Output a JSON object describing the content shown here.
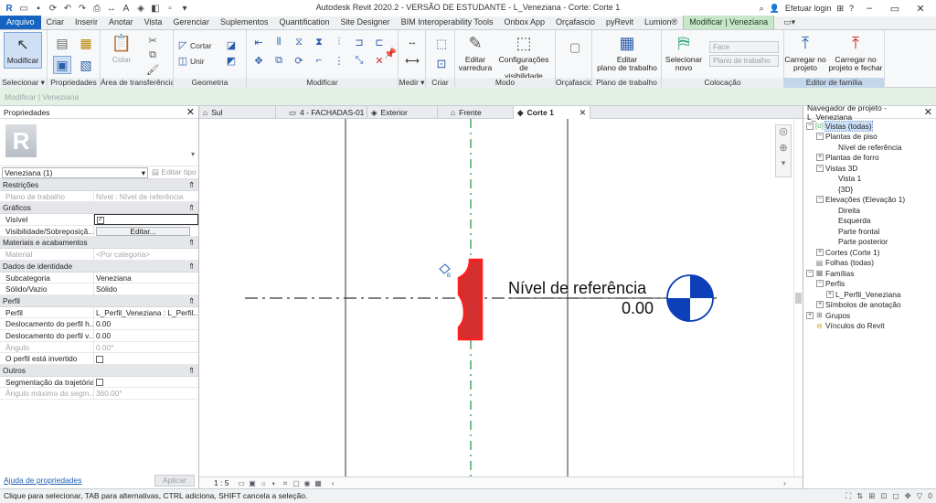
{
  "window": {
    "title": "Autodesk Revit 2020.2 - VERSÃO DE ESTUDANTE - L_Veneziana - Corte: Corte 1",
    "login": "Efetuar login"
  },
  "ribbon_tabs": [
    "Arquivo",
    "Criar",
    "Inserir",
    "Anotar",
    "Vista",
    "Gerenciar",
    "Suplementos",
    "Quantification",
    "Site Designer",
    "BIM Interoperability Tools",
    "Onbox App",
    "Orçafascio",
    "pyRevit",
    "Lumion®",
    "Modificar | Veneziana"
  ],
  "ribbon": {
    "modificar": "Modificar",
    "colar": "Colar",
    "cortar": "Cortar",
    "unir": "Unir",
    "editar_varredura": [
      "Editar",
      "varredura"
    ],
    "config_visibilidade": [
      "Configurações de",
      "visibilidade"
    ],
    "editar_plano": [
      "Editar",
      "plano de trabalho"
    ],
    "selecionar_novo": [
      "Selecionar",
      "novo"
    ],
    "face": "Face",
    "plano_trabalho": "Plano de trabalho",
    "carregar_projeto": [
      "Carregar no",
      "projeto"
    ],
    "carregar_fechar": [
      "Carregar no",
      "projeto e fechar"
    ],
    "panels": {
      "selecionar": "Selecionar ▾",
      "propriedades": "Propriedades",
      "transferencia": "Área de transferência",
      "geometria": "Geometria",
      "modificar": "Modificar",
      "medir": "Medir ▾",
      "criar": "Criar",
      "modo": "Modo",
      "orcafascio": "Orçafascio",
      "plano": "Plano de trabalho",
      "colocacao": "Colocação",
      "editor": "Editor de família"
    }
  },
  "options_bar": "Modificar | Veneziana",
  "properties": {
    "title": "Propriedades",
    "type_name": "Veneziana (1)",
    "edit_type": "Editar tipo",
    "help_link": "Ajuda de propriedades",
    "apply": "Aplicar",
    "sections": {
      "restricoes": "Restrições",
      "graficos": "Gráficos",
      "materiais": "Materiais e acabamentos",
      "identidade": "Dados de identidade",
      "perfil": "Perfil",
      "outros": "Outros"
    },
    "rows": {
      "plano_k": "Plano de trabalho",
      "plano_v": "Nível : Nível de referência",
      "visivel_k": "Visível",
      "vis_k": "Visibilidade/Sobreposiçã...",
      "vis_v": "Editar...",
      "material_k": "Material",
      "material_v": "<Por categoria>",
      "subcat_k": "Subcategoria",
      "subcat_v": "Veneziana",
      "solido_k": "Sólido/Vazio",
      "solido_v": "Sólido",
      "perfil_k": "Perfil",
      "perfil_v": "L_Perfil_Veneziana : L_Perfil...",
      "deslh_k": "Deslocamento do perfil h...",
      "deslh_v": "0.00",
      "deslv_k": "Deslocamento do perfil v...",
      "deslv_v": "0.00",
      "angulo_k": "Ângulo",
      "angulo_v": "0.00°",
      "invertido_k": "O perfil está invertido",
      "segm_k": "Segmentação da trajetória",
      "angmax_k": "Ângulo máximo do segm...",
      "angmax_v": "360.00°"
    }
  },
  "view_tabs": [
    "Sul",
    "4 - FACHADAS-01",
    "Exterior",
    "Frente",
    "Corte 1"
  ],
  "view": {
    "level_name": "Nível de referência",
    "level_value": "0.00",
    "scale": "1 : 5"
  },
  "browser": {
    "title": "Navegador de projeto - L_Veneziana",
    "items": [
      "Vistas (todas)",
      "Plantas de piso",
      "Nível de referência",
      "Plantas de forro",
      "Vistas 3D",
      "Vista 1",
      "{3D}",
      "Elevações (Elevação 1)",
      "Direita",
      "Esquerda",
      "Parte frontal",
      "Parte posterior",
      "Cortes (Corte 1)",
      "Folhas (todas)",
      "Famílias",
      "Perfis",
      "L_Perfil_Veneziana",
      "Símbolos de anotação",
      "Grupos",
      "Vínculos do Revit"
    ]
  },
  "status": {
    "message": "Clique para selecionar, TAB para alternativas, CTRL adiciona, SHIFT cancela a seleção.",
    "filter_count": "0"
  },
  "colors": {
    "file_tab": "#1565c0",
    "contextual_tab": "#c8e6c9",
    "selected_element": "#e53935",
    "level_symbol": "#0d3fb8",
    "centerline": "#3aa655"
  }
}
